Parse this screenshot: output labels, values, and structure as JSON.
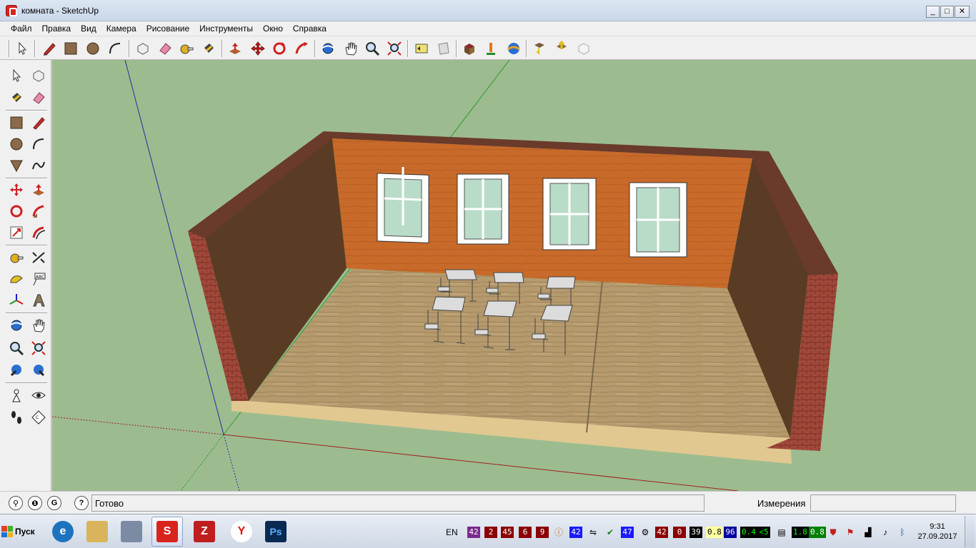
{
  "window": {
    "title": "комната - SketchUp",
    "min": "_",
    "max": "□",
    "close": "✕"
  },
  "menu": [
    "Файл",
    "Правка",
    "Вид",
    "Камера",
    "Рисование",
    "Инструменты",
    "Окно",
    "Справка"
  ],
  "toolbar": {
    "icons": [
      "select-icon",
      "pencil-icon",
      "rectangle-icon",
      "circle-icon",
      "arc-icon",
      "make-component-icon",
      "eraser-icon",
      "tape-measure-icon",
      "paint-bucket-icon",
      "push-pull-icon",
      "move-icon",
      "rotate-icon",
      "follow-me-icon",
      "orbit-icon",
      "pan-icon",
      "zoom-icon",
      "zoom-extents-icon",
      "previous-view-icon",
      "next-view-icon",
      "get-models-icon",
      "share-model-icon",
      "warehouse-icon",
      "get-components-icon",
      "share-component-icon",
      "extension-icon"
    ]
  },
  "palette": {
    "icons": [
      "select-icon",
      "component-icon",
      "paint-bucket-icon",
      "eraser-icon",
      "rectangle-icon",
      "line-icon",
      "circle-icon",
      "arc-icon",
      "polygon-icon",
      "freehand-icon",
      "move-icon",
      "push-pull-icon",
      "rotate-icon",
      "follow-me-icon",
      "scale-icon",
      "offset-icon",
      "tape-measure-icon",
      "dimension-icon",
      "protractor-icon",
      "text-icon",
      "axes-icon",
      "3d-text-icon",
      "orbit-icon",
      "pan-icon",
      "zoom-icon",
      "zoom-window-icon",
      "previous-view-icon",
      "zoom-extents-icon",
      "position-camera-icon",
      "look-around-icon",
      "walk-icon",
      "section-plane-icon"
    ]
  },
  "status": {
    "text": "Готово",
    "measurements_label": "Измерения",
    "measurements_value": "",
    "help": "?"
  },
  "taskbar": {
    "start_label": "Пуск",
    "apps": [
      {
        "name": "internet-explorer",
        "label": "e",
        "color": "#1e73be"
      },
      {
        "name": "file-explorer",
        "label": "",
        "color": "#d9b45a"
      },
      {
        "name": "calculator",
        "label": "",
        "color": "#7b8ba3"
      },
      {
        "name": "sketchup",
        "label": "S",
        "color": "#d9241c"
      },
      {
        "name": "filezilla",
        "label": "Z",
        "color": "#bf1e1e"
      },
      {
        "name": "yandex-browser",
        "label": "Y",
        "color": "#ffffff"
      },
      {
        "name": "photoshop",
        "label": "Ps",
        "color": "#0a2a52"
      }
    ],
    "lang": "EN",
    "tray": [
      {
        "text": "42",
        "bg": "#7a2a8c",
        "fg": "#fff"
      },
      {
        "text": "2",
        "bg": "#8b0000",
        "fg": "#fff"
      },
      {
        "text": "45",
        "bg": "#8b0000",
        "fg": "#fff"
      },
      {
        "text": "6",
        "bg": "#8b0000",
        "fg": "#fff"
      },
      {
        "text": "9",
        "bg": "#8b0000",
        "fg": "#fff"
      },
      {
        "text": "42",
        "bg": "#1a1aff",
        "fg": "#fff"
      },
      {
        "text": "47",
        "bg": "#1a1aff",
        "fg": "#fff"
      },
      {
        "text": "42",
        "bg": "#8b0000",
        "fg": "#fff"
      },
      {
        "text": "0",
        "bg": "#8b0000",
        "fg": "#fff"
      },
      {
        "text": "39",
        "bg": "#000000",
        "fg": "#fff"
      },
      {
        "text": "0.8",
        "bg": "#ffffa0",
        "fg": "#000"
      },
      {
        "text": "96",
        "bg": "#0000a0",
        "fg": "#fff"
      },
      {
        "text": "0.4",
        "bg": "#000000",
        "fg": "#0f0"
      },
      {
        "text": "<5",
        "bg": "#000000",
        "fg": "#0f0"
      },
      {
        "text": "1.8",
        "bg": "#000000",
        "fg": "#0f0"
      },
      {
        "text": "0.8",
        "bg": "#008000",
        "fg": "#fff"
      }
    ],
    "time": "9:31",
    "date": "27.09.2017"
  }
}
